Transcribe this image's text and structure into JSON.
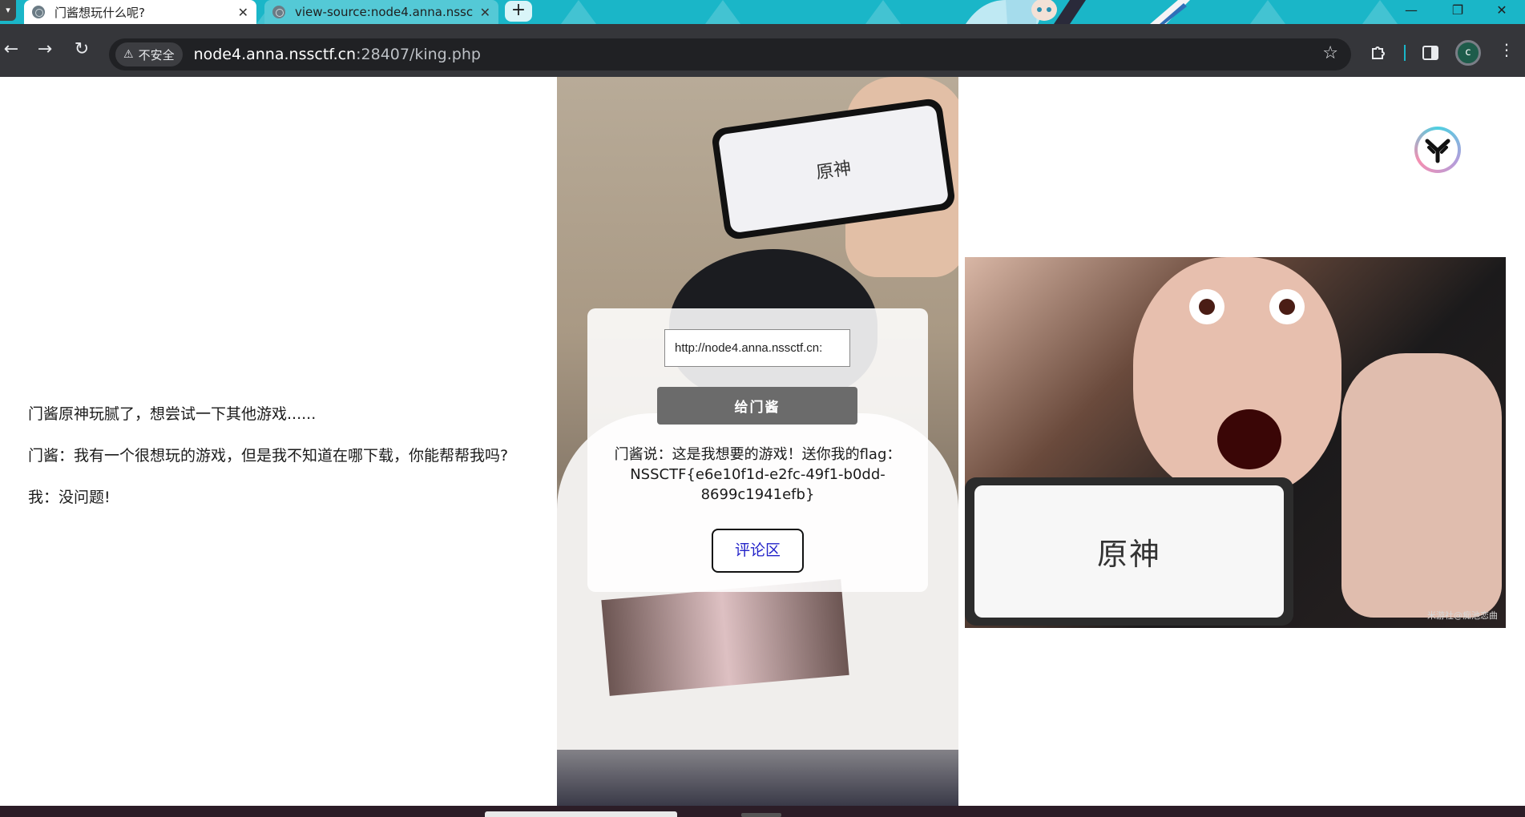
{
  "browser": {
    "tabs": [
      {
        "title": "门酱想玩什么呢?",
        "close": "✕",
        "active": true
      },
      {
        "title": "view-source:node4.anna.nssc",
        "close": "✕",
        "active": false
      }
    ],
    "new_tab": "+",
    "window_controls": {
      "minimize": "—",
      "restore": "❐",
      "close": "✕"
    },
    "nav": {
      "back": "←",
      "forward": "→",
      "reload": "↻"
    },
    "security_label": "不安全",
    "url_host": "node4.anna.nssctf.cn",
    "url_rest": ":28407/king.php",
    "profile_initial": "c"
  },
  "story": {
    "lines": [
      "门酱原神玩腻了，想尝试一下其他游戏......",
      "门酱：我有一个很想玩的游戏，但是我不知道在哪下载，你能帮帮我吗?",
      "我：没问题!"
    ]
  },
  "form": {
    "url_value": "http://node4.anna.nssctf.cn:",
    "submit_label": "给门酱",
    "result_text": "门酱说：这是我想要的游戏！送你我的flag：NSSCTF{e6e10f1d-e2fc-49f1-b0dd-8699c1941efb}",
    "comment_label": "评论区"
  },
  "images": {
    "phone_logo_text": "原神",
    "meme_logo_text": "原神",
    "meme_watermark": "米游社@痴池恋曲"
  },
  "colors": {
    "tabstrip": "#1ab6c8",
    "toolbar": "#35363a",
    "submit_button": "#6b6b6b",
    "comment_link": "#2323c9"
  }
}
